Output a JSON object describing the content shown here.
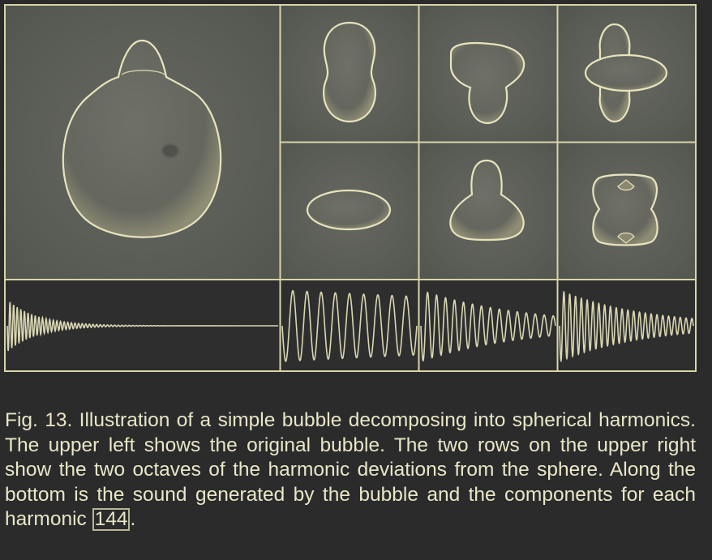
{
  "figure": {
    "colors": {
      "background": "#2b2b2b",
      "frame": "#d8d4a8",
      "panel": "#5d5f59",
      "bubble_fill": "#6b6d63",
      "bubble_edge": "#e7e3bd",
      "waveform": "#d9d6b2",
      "waveform_bg": "#2e2e2e"
    },
    "panels": [
      {
        "name": "original-bubble-panel",
        "shape": "original-bubble"
      },
      {
        "name": "harmonic-panel-1",
        "shape": "vertical-peanut"
      },
      {
        "name": "harmonic-panel-2",
        "shape": "mushroom"
      },
      {
        "name": "harmonic-panel-3",
        "shape": "cross-disc"
      },
      {
        "name": "harmonic-panel-4",
        "shape": "horizontal-capsule"
      },
      {
        "name": "harmonic-panel-5",
        "shape": "bell"
      },
      {
        "name": "harmonic-panel-6",
        "shape": "pinched-block"
      }
    ],
    "waveforms": [
      {
        "name": "original-sound",
        "description_shape": "fast decaying burst"
      },
      {
        "name": "harmonic-sound-1",
        "description_shape": "slow low oscillation"
      },
      {
        "name": "harmonic-sound-2",
        "description_shape": "medium oscillation decaying"
      },
      {
        "name": "harmonic-sound-3",
        "description_shape": "high oscillation decaying"
      }
    ]
  },
  "caption": {
    "text_before_citation": "Fig. 13. Illustration of a simple bubble decomposing into spherical harmonics. The upper left shows the original bubble. The two rows on the upper right show the two octaves of the harmonic deviations from the sphere. Along the bottom is the sound generated by the bubble and the components for each harmonic ",
    "citation": "144",
    "text_after_citation": "."
  }
}
